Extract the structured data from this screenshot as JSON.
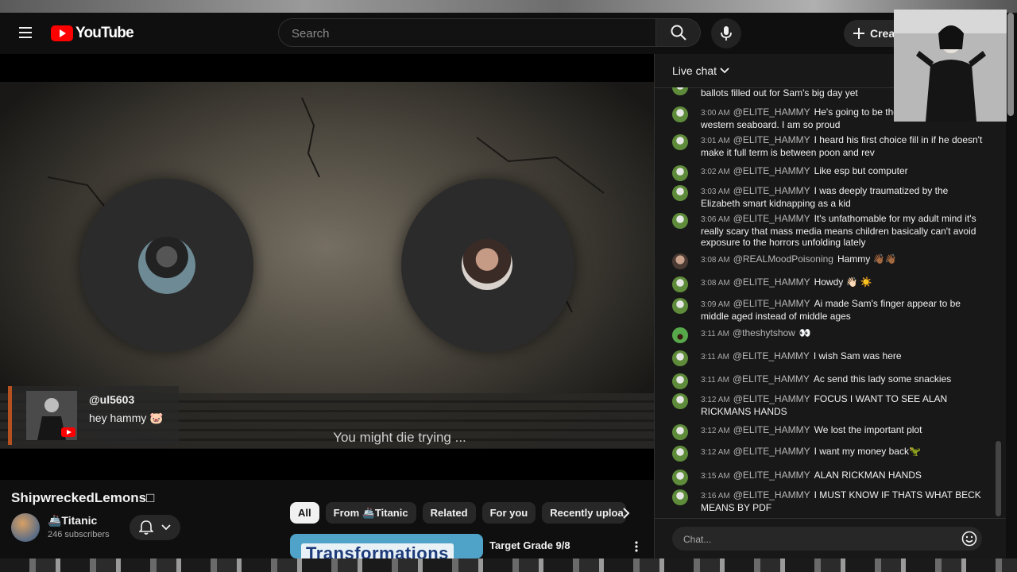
{
  "header": {
    "logo_text": "YouTube",
    "search_placeholder": "Search",
    "create_label": "Creat"
  },
  "player": {
    "comment_author": "@ul5603",
    "comment_text": "hey hammy 🐷",
    "subtitle": "You might die trying ..."
  },
  "video": {
    "title": "ShipwreckedLemons□",
    "channel_name": "🚢Titanic",
    "subscribers": "246 subscribers"
  },
  "chips": [
    "All",
    "From 🚢Titanic",
    "Related",
    "For you",
    "Recently uploa"
  ],
  "recommendation": {
    "thumb_text": "Transformations",
    "title": "Target Grade 9/8"
  },
  "chat": {
    "title": "Live chat",
    "input_placeholder": "Chat...",
    "messages": [
      {
        "time": "",
        "author": "",
        "text": "ballots filled out for Sam's big day yet"
      },
      {
        "time": "3:00 AM",
        "author": "@ELITE_HAMMY",
        "text": "He's going to be the f a wish on the western seaboard. I am so proud"
      },
      {
        "time": "3:01 AM",
        "author": "@ELITE_HAMMY",
        "text": "I heard his first choice fill in if he doesn't make it full term is between poon and rev"
      },
      {
        "time": "3:02 AM",
        "author": "@ELITE_HAMMY",
        "text": "Like esp but computer"
      },
      {
        "time": "3:03 AM",
        "author": "@ELITE_HAMMY",
        "text": "I was deeply traumatized by the Elizabeth smart kidnapping as a kid"
      },
      {
        "time": "3:06 AM",
        "author": "@ELITE_HAMMY",
        "text": "It's unfathomable for my adult mind it's really scary that mass media means children basically can't avoid exposure to the horrors unfolding lately"
      },
      {
        "time": "3:08 AM",
        "author": "@REALMoodPoisoning",
        "text": "Hammy 👋🏾👋🏾"
      },
      {
        "time": "3:08 AM",
        "author": "@ELITE_HAMMY",
        "text": "Howdy 👋🏻 ☀️"
      },
      {
        "time": "3:09 AM",
        "author": "@ELITE_HAMMY",
        "text": "Ai made Sam's finger appear to be middle aged instead of middle ages"
      },
      {
        "time": "3:11 AM",
        "author": "@theshytshow",
        "text": "👀"
      },
      {
        "time": "3:11 AM",
        "author": "@ELITE_HAMMY",
        "text": "I wish Sam was here"
      },
      {
        "time": "3:11 AM",
        "author": "@ELITE_HAMMY",
        "text": "Ac send this lady some snackies"
      },
      {
        "time": "3:12 AM",
        "author": "@ELITE_HAMMY",
        "text": "FOCUS I WANT TO SEE ALAN RICKMANS HANDS"
      },
      {
        "time": "3:12 AM",
        "author": "@ELITE_HAMMY",
        "text": "We lost the important plot"
      },
      {
        "time": "3:12 AM",
        "author": "@ELITE_HAMMY",
        "text": "I want my money back🦖"
      },
      {
        "time": "3:15 AM",
        "author": "@ELITE_HAMMY",
        "text": "ALAN RICKMAN HANDS"
      },
      {
        "time": "3:16 AM",
        "author": "@ELITE_HAMMY",
        "text": "I MUST KNOW IF THATS WHAT BECK MEANS BY PDF"
      }
    ]
  },
  "colors": {
    "background": "#0f0f0f",
    "chat_background": "#181818",
    "youtube_red": "#ff0000",
    "comment_accent": "#b5511e"
  }
}
